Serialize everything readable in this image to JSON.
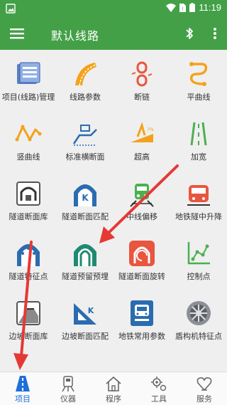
{
  "status_bar": {
    "time": "11:19"
  },
  "app_bar": {
    "title": "默认线路"
  },
  "grid": {
    "items": [
      {
        "label": "项目(线路)管理",
        "icon": "project-management-icon"
      },
      {
        "label": "线路参数",
        "icon": "route-parameters-icon"
      },
      {
        "label": "断链",
        "icon": "broken-chain-icon"
      },
      {
        "label": "平曲线",
        "icon": "horizontal-curve-icon"
      },
      {
        "label": "竖曲线",
        "icon": "vertical-curve-icon"
      },
      {
        "label": "标准横断面",
        "icon": "standard-cross-section-icon"
      },
      {
        "label": "超高",
        "icon": "superelevation-icon"
      },
      {
        "label": "加宽",
        "icon": "widening-icon"
      },
      {
        "label": "隧道断面库",
        "icon": "tunnel-section-library-icon"
      },
      {
        "label": "隧道断面匹配",
        "icon": "tunnel-section-match-icon"
      },
      {
        "label": "中线偏移",
        "icon": "centerline-offset-icon"
      },
      {
        "label": "地铁隧中升降",
        "icon": "metro-tunnel-lift-icon"
      },
      {
        "label": "隧道特征点",
        "icon": "tunnel-feature-point-icon"
      },
      {
        "label": "隧道预留预埋",
        "icon": "tunnel-reserved-embedded-icon"
      },
      {
        "label": "隧道断面旋转",
        "icon": "tunnel-section-rotate-icon"
      },
      {
        "label": "控制点",
        "icon": "control-point-icon"
      },
      {
        "label": "边坡断面库",
        "icon": "slope-section-library-icon"
      },
      {
        "label": "边坡断面匹配",
        "icon": "slope-section-match-icon"
      },
      {
        "label": "地铁常用参数",
        "icon": "metro-common-params-icon"
      },
      {
        "label": "盾构机特征点",
        "icon": "shield-machine-feature-icon"
      }
    ]
  },
  "bottom_nav": {
    "items": [
      {
        "label": "项目",
        "icon": "project-road-icon",
        "active": true
      },
      {
        "label": "仪器",
        "icon": "instrument-icon",
        "active": false
      },
      {
        "label": "程序",
        "icon": "program-home-icon",
        "active": false
      },
      {
        "label": "工具",
        "icon": "tools-gear-icon",
        "active": false
      },
      {
        "label": "服务",
        "icon": "service-heart-icon",
        "active": false
      }
    ]
  },
  "colors": {
    "primary": "#43a047",
    "background": "#efefef",
    "active_nav": "#1e6fd9",
    "annotation_arrow": "#e53935"
  }
}
